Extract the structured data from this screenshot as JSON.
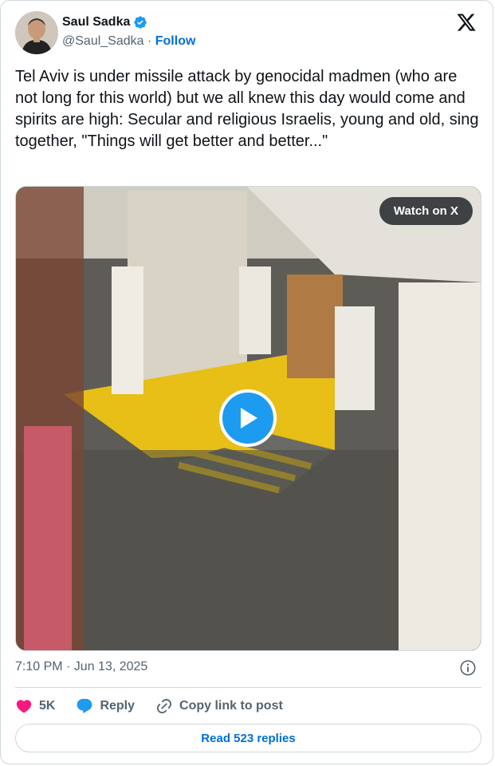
{
  "author": {
    "name": "Saul Sadka",
    "handle": "@Saul_Sadka",
    "separator": " · ",
    "follow_label": "Follow"
  },
  "tweet": {
    "text": "Tel Aviv is under missile attack by genocidal madmen (who are not long for this world) but we all knew this day would come and spirits are high: Secular and religious Israelis, young and old, sing together, \"Things will get better and better...\"",
    "timestamp": "7:10 PM · Jun 13, 2025"
  },
  "media": {
    "watch_label": "Watch on X",
    "icons": [
      "play-icon"
    ]
  },
  "actions": {
    "like_count": "5K",
    "reply_label": "Reply",
    "copy_label": "Copy link to post"
  },
  "read_replies_label": "Read 523 replies",
  "colors": {
    "brand_blue": "#1d9bf0",
    "link_blue": "#006fd6",
    "like_pink": "#f91880",
    "muted_text": "#536471",
    "border": "#cfd9de"
  }
}
